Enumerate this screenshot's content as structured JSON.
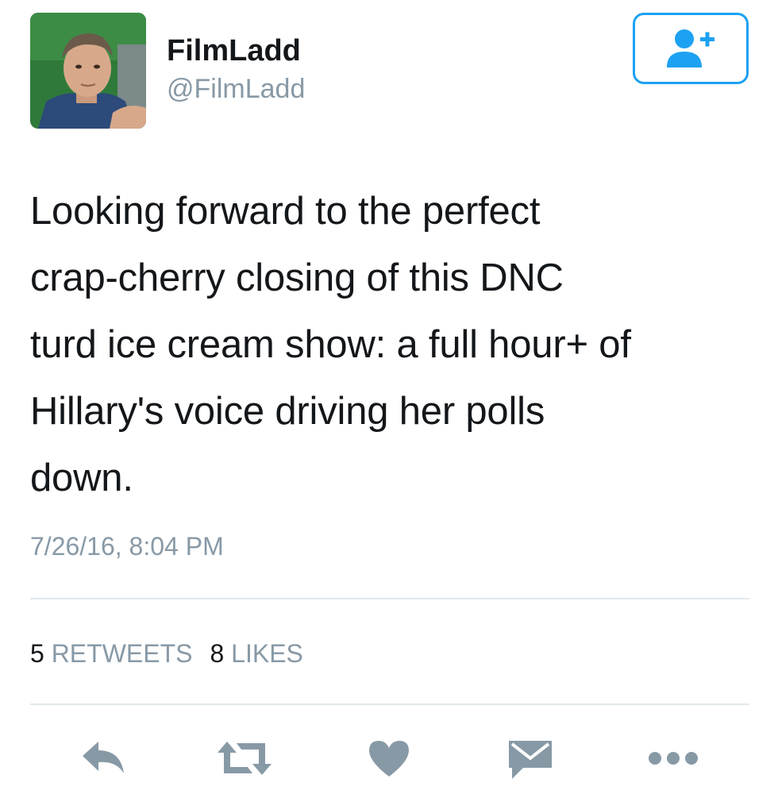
{
  "user": {
    "display_name": "FilmLadd",
    "handle": "@FilmLadd",
    "avatar_icon": "profile-photo"
  },
  "follow_button": {
    "icon": "follow-user-plus-icon",
    "color": "#1da1f2"
  },
  "tweet": {
    "lines": [
      "Looking forward to the perfect",
      "crap-cherry closing of this DNC",
      "turd ice cream show: a full hour+ of",
      "Hillary's voice driving her polls",
      "down."
    ],
    "timestamp": "7/26/16, 8:04 PM"
  },
  "stats": {
    "retweets_count": "5",
    "retweets_label": "RETWEETS",
    "likes_count": "8",
    "likes_label": "LIKES"
  },
  "actions": {
    "icons": [
      "reply-icon",
      "retweet-icon",
      "like-heart-icon",
      "direct-message-icon",
      "more-options-icon"
    ],
    "icon_color": "#8899a6"
  }
}
